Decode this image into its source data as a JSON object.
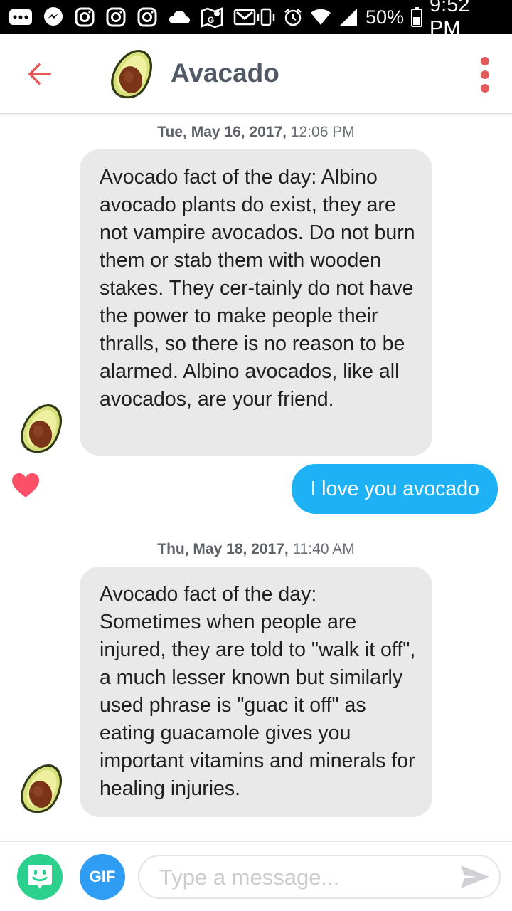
{
  "status_bar": {
    "battery": "50%",
    "time": "9:52 PM",
    "left_icons": [
      "more-icon",
      "messenger-icon",
      "instagram-icon",
      "instagram-icon",
      "instagram-icon",
      "cloud-icon",
      "maps-icon",
      "gmail-icon"
    ],
    "right_icons": [
      "vibrate-icon",
      "alarm-icon",
      "wifi-icon",
      "signal-icon",
      "battery-icon"
    ]
  },
  "header": {
    "contact_name": "Avacado"
  },
  "conversation": {
    "sections": [
      {
        "date": "Tue, May 16, 2017,",
        "time": "12:06 PM",
        "incoming_text": "Avocado fact of the day: Albino avocado plants do exist, they are not vampire avocados. Do not burn them or stab them with wooden stakes. They cer-tainly do not have the power to make people their thralls, so there is no reason to be alarmed. Albino avocados, like all avocados, are your friend.",
        "outgoing_text": "I love you avocado"
      },
      {
        "date": "Thu, May 18, 2017,",
        "time": "11:40 AM",
        "incoming_text": "Avocado fact of the day: Sometimes when people are injured, they are told to \"walk it off\", a much lesser known but similarly used phrase is \"guac it off\" as eating guacamole gives you important vitamins and minerals for healing injuries."
      }
    ]
  },
  "composer": {
    "gif_label": "GIF",
    "placeholder": "Type a message..."
  },
  "colors": {
    "accent": "#e45a5a",
    "outgoing_bubble": "#1eb1f5",
    "incoming_bubble": "#e9e9ea",
    "heart": "#fd5068",
    "bitmoji": "#2ad08b",
    "gif": "#2f9df4"
  }
}
